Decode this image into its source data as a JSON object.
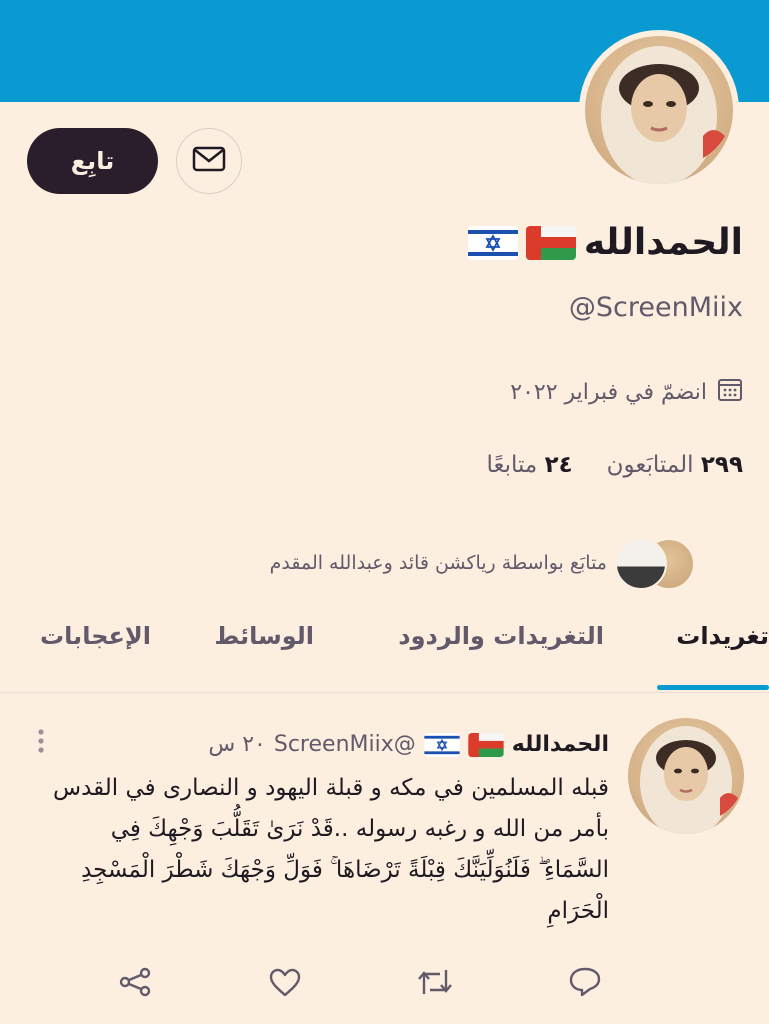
{
  "profile": {
    "name": "الحمدالله",
    "handle": "@ScreenMiix",
    "joined": "انضمّ في فبراير ٢٠٢٢",
    "following_count": "٢٩٩",
    "following_label": "المتابَعون",
    "followers_count": "٢٤",
    "followers_label": "متابعًا",
    "followed_by": "متابَع بواسطة رياكشن قائد وعبدالله المقدم"
  },
  "actions": {
    "follow_label": "تابِع"
  },
  "tabs": [
    {
      "label": "تغريدات",
      "active": true
    },
    {
      "label": "التغريدات والردود",
      "active": false
    },
    {
      "label": "الوسائط",
      "active": false
    },
    {
      "label": "الإعجابات",
      "active": false
    }
  ],
  "tweet": {
    "name": "الحمدالله",
    "handle": "@ScreenMiix",
    "time": "٢٠ س",
    "text": "قبله المسلمين في مكه و قبلة اليهود و النصارى في القدس بأمر من الله و رغبه رسوله ..قَدْ نَرَىٰ تَقَلُّبَ وَجْهِكَ فِي السَّمَاءِ ۖ فَلَنُوَلِّيَنَّكَ قِبْلَةً تَرْضَاهَا ۚ فَوَلِّ وَجْهَكَ شَطْرَ الْمَسْجِدِ الْحَرَامِ"
  },
  "colors": {
    "background": "#fdefe0",
    "banner": "#0a9ad2",
    "button_dark": "#2b1e2c",
    "muted_text": "#62596a"
  },
  "icons": [
    "mail-icon",
    "calendar-icon",
    "oman-flag-icon",
    "israel-flag-icon",
    "more-icon",
    "reply-icon",
    "retweet-icon",
    "like-icon",
    "share-icon"
  ]
}
